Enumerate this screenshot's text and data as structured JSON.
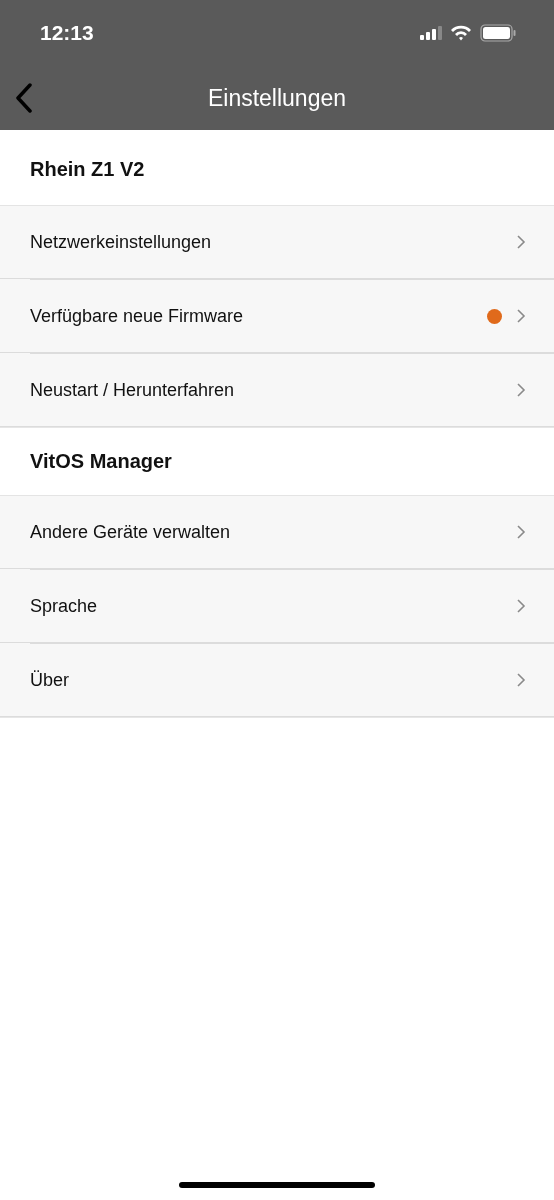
{
  "status_bar": {
    "time": "12:13"
  },
  "nav": {
    "title": "Einstellungen"
  },
  "sections": [
    {
      "title": "Rhein Z1 V2",
      "items": [
        {
          "label": "Netzwerkeinstellungen",
          "badge": false
        },
        {
          "label": "Verfügbare neue Firmware",
          "badge": true
        },
        {
          "label": "Neustart / Herunterfahren",
          "badge": false
        }
      ]
    },
    {
      "title": "VitOS Manager",
      "items": [
        {
          "label": "Andere Geräte verwalten",
          "badge": false
        },
        {
          "label": "Sprache",
          "badge": false
        },
        {
          "label": "Über",
          "badge": false
        }
      ]
    }
  ]
}
